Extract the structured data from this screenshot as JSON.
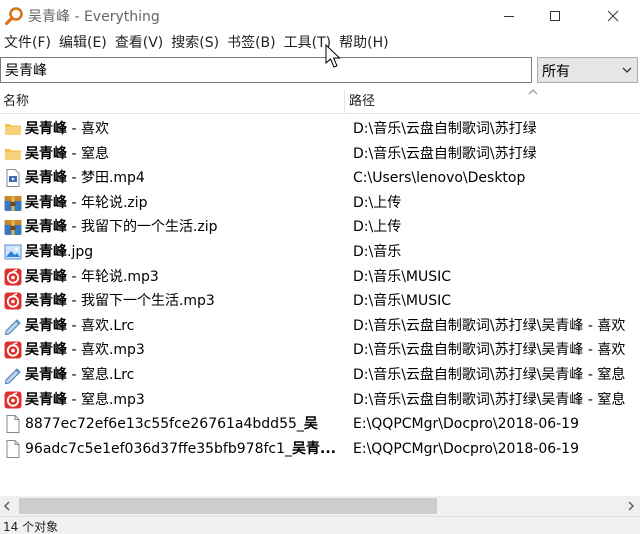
{
  "window": {
    "title": "吴青峰 - Everything",
    "app_icon": "magnifier-icon"
  },
  "menu": [
    "文件(F)",
    "编辑(E)",
    "查看(V)",
    "搜索(S)",
    "书签(B)",
    "工具(T)",
    "帮助(H)"
  ],
  "search": {
    "value": "吴青峰",
    "filter_value": "所有"
  },
  "columns": {
    "name": "名称",
    "path": "路径"
  },
  "files": [
    {
      "icon": "folder-icon",
      "bold": "吴青峰",
      "rest": " - 喜欢",
      "path": "D:\\音乐\\云盘自制歌词\\苏打绿"
    },
    {
      "icon": "folder-icon",
      "bold": "吴青峰",
      "rest": " - 窒息",
      "path": "D:\\音乐\\云盘自制歌词\\苏打绿"
    },
    {
      "icon": "video-file-icon",
      "bold": "吴青峰",
      "rest": " - 梦田.mp4",
      "path": "C:\\Users\\lenovo\\Desktop"
    },
    {
      "icon": "zip-archive-icon",
      "bold": "吴青峰",
      "rest": " - 年轮说.zip",
      "path": "D:\\上传"
    },
    {
      "icon": "zip-archive-icon",
      "bold": "吴青峰",
      "rest": " - 我留下的一个生活.zip",
      "path": "D:\\上传"
    },
    {
      "icon": "image-file-icon",
      "bold": "吴青峰",
      "rest": ".jpg",
      "path": "D:\\音乐"
    },
    {
      "icon": "music-file-icon",
      "bold": "吴青峰",
      "rest": " - 年轮说.mp3",
      "path": "D:\\音乐\\MUSIC"
    },
    {
      "icon": "music-file-icon",
      "bold": "吴青峰",
      "rest": " - 我留下一个生活.mp3",
      "path": "D:\\音乐\\MUSIC"
    },
    {
      "icon": "lyric-file-icon",
      "bold": "吴青峰",
      "rest": " - 喜欢.Lrc",
      "path": "D:\\音乐\\云盘自制歌词\\苏打绿\\吴青峰 - 喜欢"
    },
    {
      "icon": "music-file-icon",
      "bold": "吴青峰",
      "rest": " - 喜欢.mp3",
      "path": "D:\\音乐\\云盘自制歌词\\苏打绿\\吴青峰 - 喜欢"
    },
    {
      "icon": "lyric-file-icon",
      "bold": "吴青峰",
      "rest": " - 窒息.Lrc",
      "path": "D:\\音乐\\云盘自制歌词\\苏打绿\\吴青峰 - 窒息"
    },
    {
      "icon": "music-file-icon",
      "bold": "吴青峰",
      "rest": " - 窒息.mp3",
      "path": "D:\\音乐\\云盘自制歌词\\苏打绿\\吴青峰 - 窒息"
    },
    {
      "icon": "blank-file-icon",
      "pre": "8877ec72ef6e13c55fce26761a4bdd55_",
      "bold": "吴",
      "rest": "",
      "path": "E:\\QQPCMgr\\Docpro\\2018-06-19"
    },
    {
      "icon": "blank-file-icon",
      "pre": "96adc7c5e1ef036d37ffe35bfb978fc1_",
      "bold": "吴青...",
      "rest": "",
      "path": "E:\\QQPCMgr\\Docpro\\2018-06-19"
    }
  ],
  "status": {
    "text": "14 个对象"
  },
  "colors": {
    "folder": "#f2c14e",
    "music": "#e0302c",
    "zip": "#3a78c2",
    "scroll_thumb": "#cdcdcd"
  }
}
